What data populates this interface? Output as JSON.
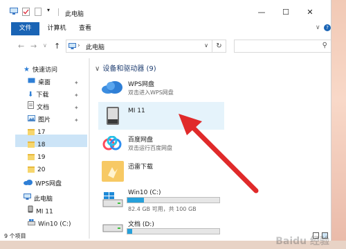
{
  "window": {
    "title": "此电脑",
    "controls": {
      "minimize": "—",
      "maximize": "☐",
      "close": "✕"
    }
  },
  "ribbon": {
    "tabs": [
      {
        "label": "文件",
        "active": true
      },
      {
        "label": "计算机"
      },
      {
        "label": "查看"
      }
    ],
    "expand_icon": "chevron-down-icon",
    "help_icon": "help-icon"
  },
  "address": {
    "back": "←",
    "forward": "→",
    "recent": "∨",
    "up": "↑",
    "separator": "›",
    "location": "此电脑",
    "dropdown": "∨",
    "refresh": "↻",
    "search_placeholder": "",
    "search_icon": "⚲"
  },
  "nav": {
    "quick_access": "快速访问",
    "items": [
      {
        "label": "桌面",
        "icon": "desktop-icon",
        "pinned": true
      },
      {
        "label": "下载",
        "icon": "download-icon",
        "pinned": true
      },
      {
        "label": "文档",
        "icon": "document-icon",
        "pinned": true
      },
      {
        "label": "图片",
        "icon": "picture-icon",
        "pinned": true
      },
      {
        "label": "17",
        "icon": "folder-icon"
      },
      {
        "label": "18",
        "icon": "folder-icon"
      },
      {
        "label": "19",
        "icon": "folder-icon"
      },
      {
        "label": "20",
        "icon": "folder-icon"
      }
    ],
    "wps": "WPS网盘",
    "this_pc": "此电脑",
    "mi11": "MI 11",
    "win10": "Win10 (C:)",
    "pin_glyph": "✦"
  },
  "content": {
    "group_header": "设备和驱动器 (9)",
    "chevron": "∨",
    "items": [
      {
        "name": "WPS网盘",
        "sub": "双击进入WPS网盘",
        "icon": "cloud-icon"
      },
      {
        "name": "MI 11",
        "sub": "",
        "icon": "phone-device-icon",
        "selected": true
      },
      {
        "name": "百度网盘",
        "sub": "双击运行百度网盘",
        "icon": "baidu-netdisk-icon"
      },
      {
        "name": "迅雷下载",
        "sub": "",
        "icon": "xunlei-icon"
      },
      {
        "name": "Win10 (C:)",
        "sub": "82.4 GB 可用，共 100 GB",
        "icon": "windows-drive-icon",
        "used_fraction": 0.18
      },
      {
        "name": "文档 (D:)",
        "sub": "",
        "icon": "drive-icon",
        "used_fraction": 0.05
      }
    ]
  },
  "status": {
    "count": "9 个项目"
  },
  "colors": {
    "accent": "#1a64b5",
    "selection": "#cce4f7",
    "arrow": "#e02a2a",
    "drive_fill": "#26a0da"
  },
  "watermark": "Baidu 经验"
}
